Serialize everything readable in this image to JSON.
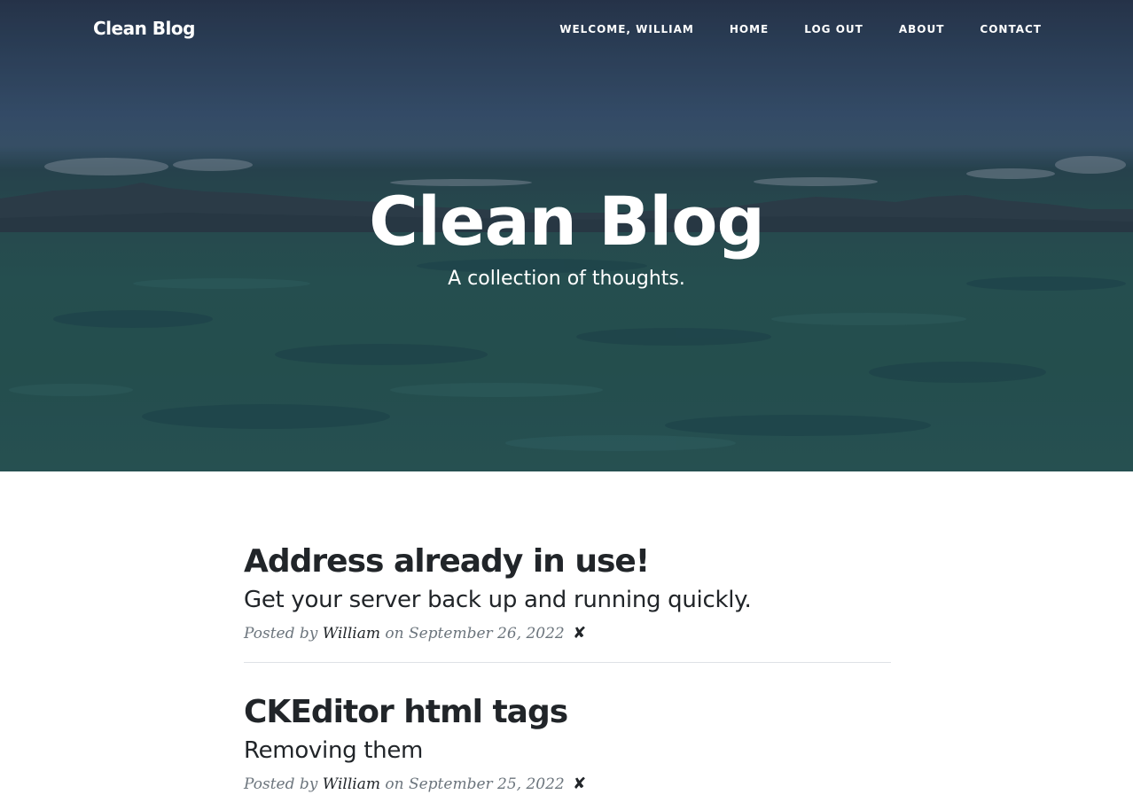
{
  "nav": {
    "brand": "Clean Blog",
    "links": [
      {
        "label": "WELCOME, WILLIAM"
      },
      {
        "label": "HOME"
      },
      {
        "label": "LOG OUT"
      },
      {
        "label": "ABOUT"
      },
      {
        "label": "CONTACT"
      }
    ]
  },
  "hero": {
    "title": "Clean Blog",
    "subtitle": "A collection of thoughts."
  },
  "posts": [
    {
      "title": "Address already in use!",
      "subtitle": "Get your server back up and running quickly.",
      "posted_by": "Posted by",
      "author": "William",
      "date": "on September 26, 2022",
      "delete_icon": "✘"
    },
    {
      "title": "CKEditor html tags",
      "subtitle": "Removing them",
      "posted_by": "Posted by",
      "author": "William",
      "date": "on September 25, 2022",
      "delete_icon": "✘"
    }
  ],
  "colors": {
    "text": "#212529",
    "muted": "#6c757d",
    "divider": "#dee2e6"
  }
}
